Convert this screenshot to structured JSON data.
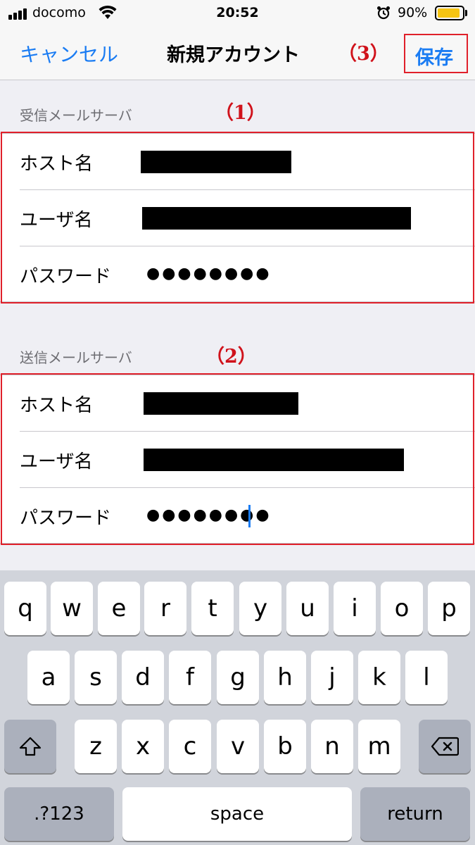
{
  "status_bar": {
    "carrier": "docomo",
    "time": "20:52",
    "battery_percent": "90%",
    "battery_level": 0.9,
    "icons": [
      "signal-icon",
      "wifi-icon",
      "alarm-icon",
      "battery-icon"
    ]
  },
  "nav": {
    "cancel_label": "キャンセル",
    "title": "新規アカウント",
    "save_label": "保存",
    "annotation": "（3）"
  },
  "incoming": {
    "header": "受信メールサーバ",
    "annotation": "（1）",
    "host_label": "ホスト名",
    "user_label": "ユーザ名",
    "password_label": "パスワード",
    "password_value": "●●●●●●●●"
  },
  "outgoing": {
    "header": "送信メールサーバ",
    "annotation": "（2）",
    "host_label": "ホスト名",
    "user_label": "ユーザ名",
    "password_label": "パスワード",
    "password_value": "●●●●●●●●"
  },
  "keyboard": {
    "row1": [
      "q",
      "w",
      "e",
      "r",
      "t",
      "y",
      "u",
      "i",
      "o",
      "p"
    ],
    "row2": [
      "a",
      "s",
      "d",
      "f",
      "g",
      "h",
      "j",
      "k",
      "l"
    ],
    "row3": [
      "z",
      "x",
      "c",
      "v",
      "b",
      "n",
      "m"
    ],
    "numbers_label": ".?123",
    "space_label": "space",
    "return_label": "return",
    "colors": {
      "background": "#d1d4db",
      "key": "#ffffff",
      "function_key": "#abb0bc"
    }
  },
  "colors": {
    "accent": "#1a7cf3",
    "annotation_red": "#e0202a",
    "background": "#efeff4"
  }
}
